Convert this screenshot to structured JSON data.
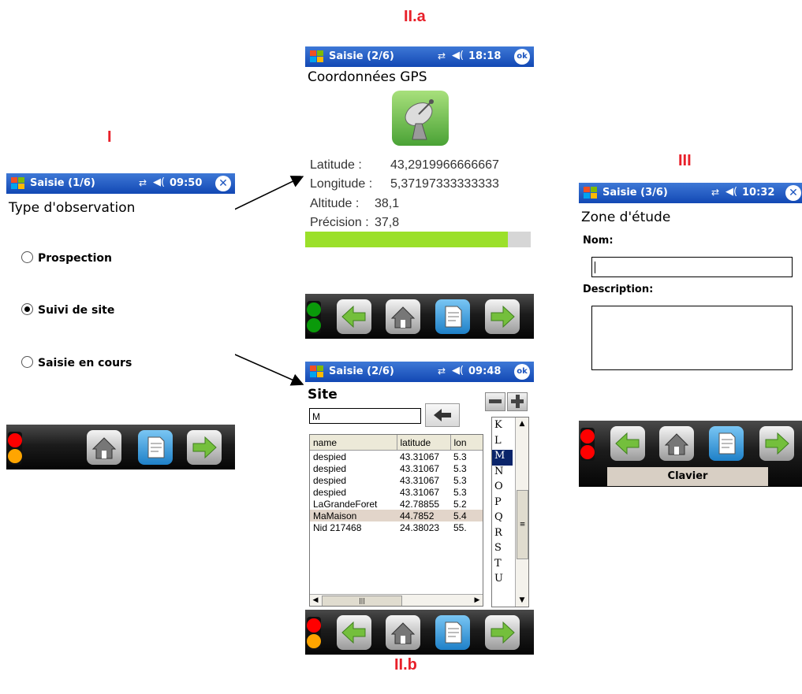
{
  "labels": {
    "screen1": "I",
    "screen2a": "II.a",
    "screen2b": "II.b",
    "screen3": "III"
  },
  "screen1": {
    "title": "Saisie (1/6)",
    "time": "09:50",
    "heading": "Type d'observation",
    "options": [
      {
        "label": "Prospection",
        "selected": false
      },
      {
        "label": "Suivi de site",
        "selected": true
      },
      {
        "label": "Saisie en cours",
        "selected": false
      }
    ],
    "light_colors": [
      "#ff0000",
      "#ffa500"
    ]
  },
  "screen2a": {
    "title": "Saisie (2/6)",
    "time": "18:18",
    "ok": "ok",
    "heading": "Coordonnées GPS",
    "fields": [
      {
        "label": "Latitude :",
        "value": "43,2919966666667"
      },
      {
        "label": "Longitude :",
        "value": "5,37197333333333"
      },
      {
        "label": "Altitude :",
        "value": "38,1"
      },
      {
        "label": "Précision :",
        "value": "37,8"
      }
    ],
    "progress": 0.9,
    "light_colors": [
      "#0a9a0a",
      "#0a9a0a"
    ]
  },
  "screen2b": {
    "title": "Saisie (2/6)",
    "time": "09:48",
    "ok": "ok",
    "heading": "Site",
    "search_value": "M",
    "columns": [
      "name",
      "latitude",
      "lon"
    ],
    "rows": [
      [
        "despied",
        "43.31067",
        "5.3"
      ],
      [
        "despied",
        "43.31067",
        "5.3"
      ],
      [
        "despied",
        "43.31067",
        "5.3"
      ],
      [
        "despied",
        "43.31067",
        "5.3"
      ],
      [
        "LaGrandeForet",
        "42.78855",
        "5.2"
      ],
      [
        "MaMaison",
        "44.7852",
        "5.4"
      ],
      [
        "Nid 217468",
        "24.38023",
        "55."
      ]
    ],
    "selected_row": 5,
    "letters": [
      "K",
      "L",
      "M",
      "N",
      "O",
      "P",
      "Q",
      "R",
      "S",
      "T",
      "U"
    ],
    "selected_letter": "M",
    "light_colors": [
      "#ff0000",
      "#ffa500"
    ]
  },
  "screen3": {
    "title": "Saisie (3/6)",
    "time": "10:32",
    "heading": "Zone d'étude",
    "name_label": "Nom:",
    "desc_label": "Description:",
    "keyboard": "Clavier",
    "light_colors": [
      "#ff0000",
      "#ff0000"
    ]
  },
  "colors": {
    "titlebar": "#1c50bc",
    "progress": "#9be02a",
    "selection": "#0a246a",
    "accent": "#e8202a"
  }
}
